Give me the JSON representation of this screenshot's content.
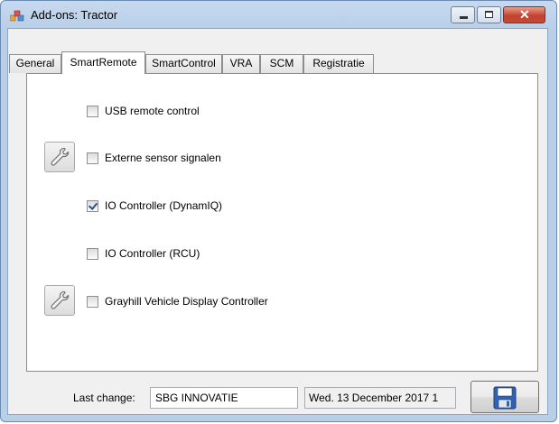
{
  "window": {
    "title": "Add-ons: Tractor",
    "icons": {
      "app": "app-icon",
      "minimize": "minimize-icon",
      "maximize": "maximize-icon",
      "close": "close-icon"
    }
  },
  "tabs": [
    {
      "label": "General",
      "active": false
    },
    {
      "label": "SmartRemote",
      "active": true
    },
    {
      "label": "SmartControl",
      "active": false
    },
    {
      "label": "VRA",
      "active": false
    },
    {
      "label": "SCM",
      "active": false
    },
    {
      "label": "Registratie",
      "active": false
    }
  ],
  "options": [
    {
      "label": "USB remote control",
      "checked": false,
      "settings_button": false
    },
    {
      "label": "Externe sensor signalen",
      "checked": false,
      "settings_button": true,
      "settings_icon": "wrench-icon"
    },
    {
      "label": "IO Controller (DynamIQ)",
      "checked": true,
      "settings_button": false
    },
    {
      "label": "IO Controller (RCU)",
      "checked": false,
      "settings_button": false
    },
    {
      "label": "Grayhill Vehicle Display Controller",
      "checked": false,
      "settings_button": true,
      "settings_icon": "wrench-icon"
    }
  ],
  "footer": {
    "last_change_label": "Last change:",
    "user": "SBG INNOVATIE",
    "date": "Wed. 13 December 2017 1",
    "save_icon": "floppy-disk-icon"
  },
  "colors": {
    "accent_checkmark": "#2a4d8f",
    "close_button": "#c6412d",
    "titlebar": "#c7d9ee"
  }
}
